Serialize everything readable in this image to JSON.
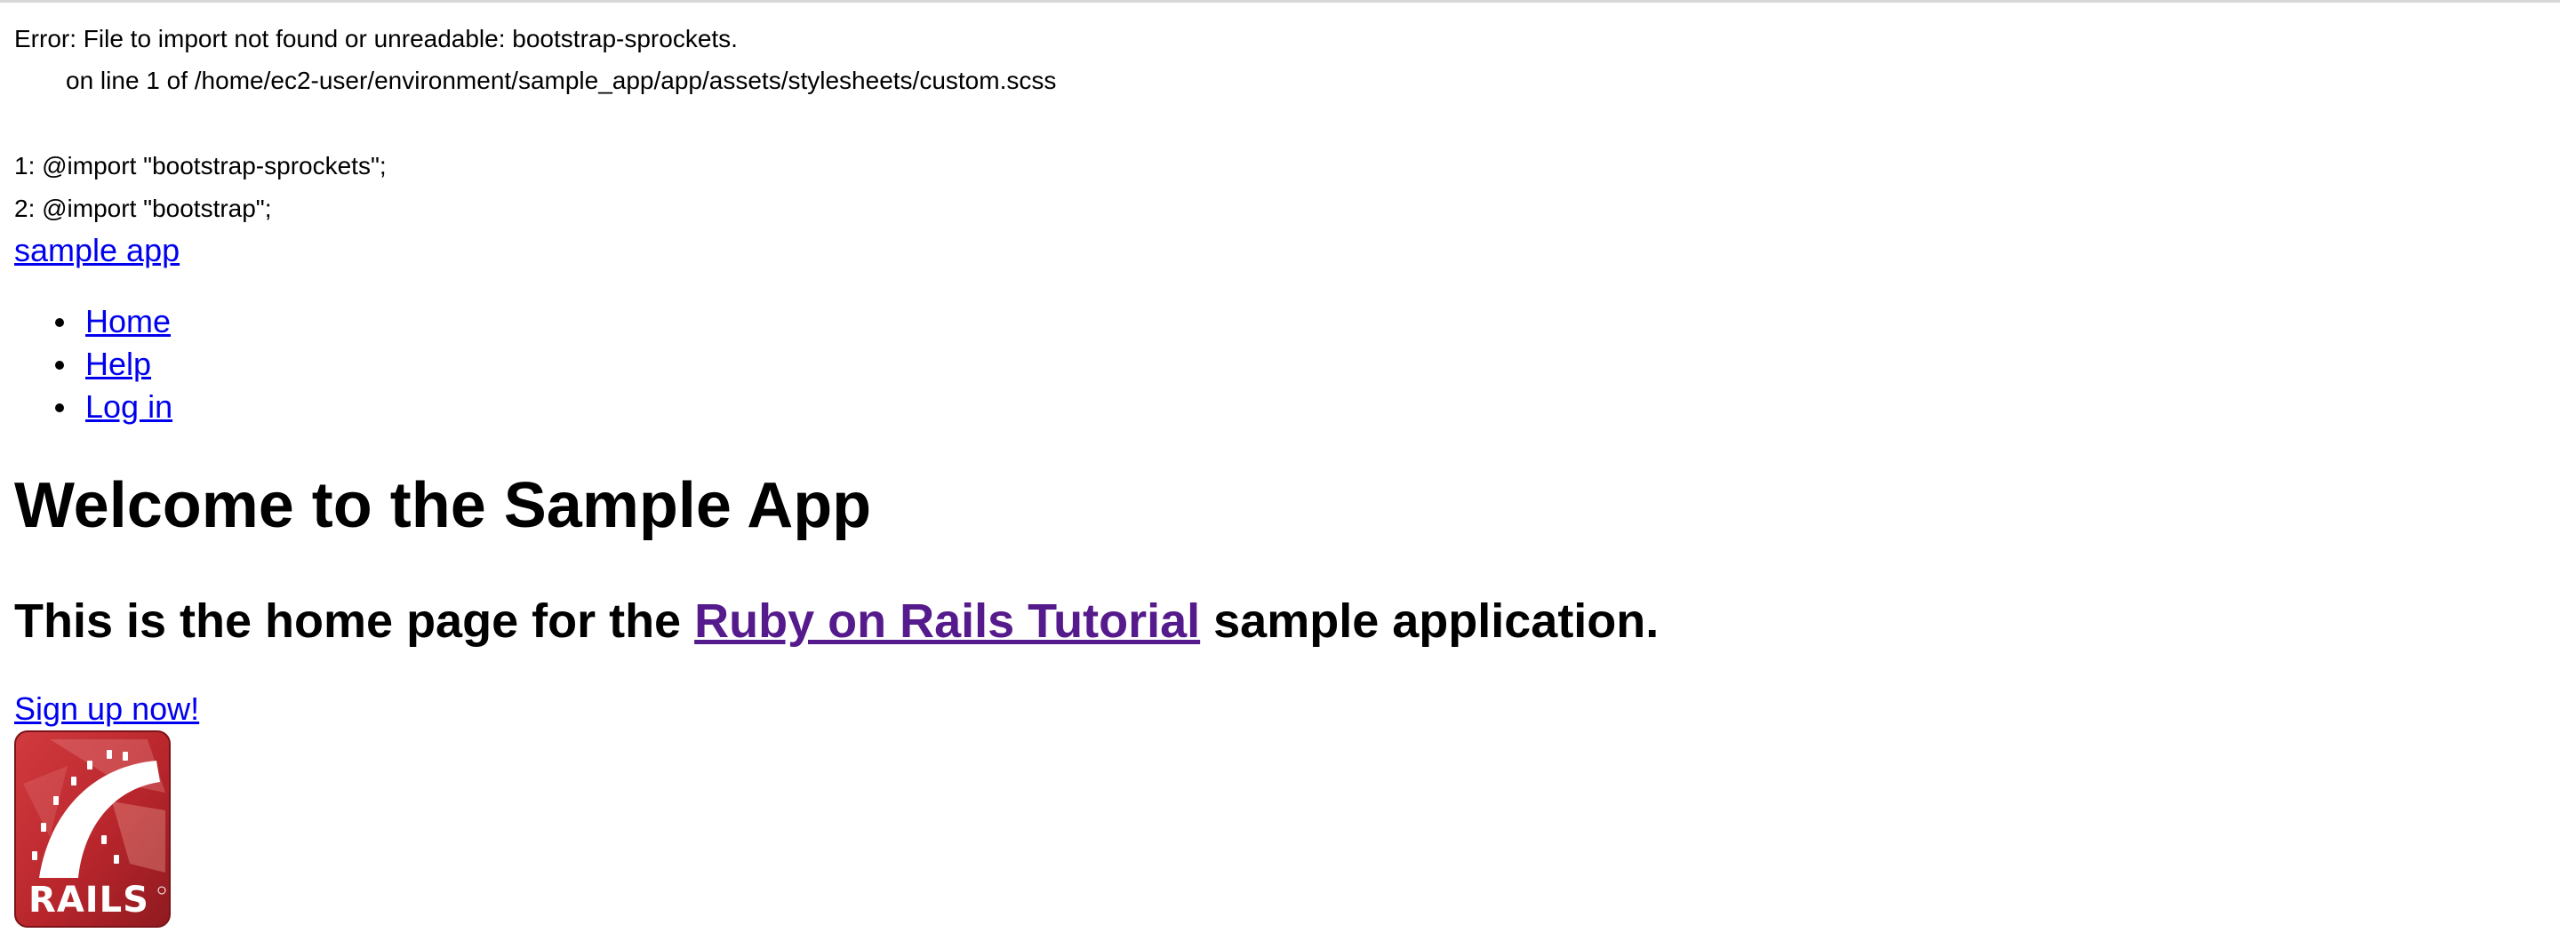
{
  "error": {
    "title": "Error: File to import not found or unreadable: bootstrap-sprockets.",
    "location": "on line 1 of /home/ec2-user/environment/sample_app/app/assets/stylesheets/custom.scss",
    "code_lines": [
      "1: @import \"bootstrap-sprockets\";",
      "2: @import \"bootstrap\";"
    ]
  },
  "header": {
    "logo_text": "sample app",
    "nav": [
      {
        "label": "Home"
      },
      {
        "label": "Help"
      },
      {
        "label": "Log in"
      }
    ]
  },
  "main": {
    "heading": "Welcome to the Sample App",
    "subheading_prefix": "This is the home page for the ",
    "subheading_link": "Ruby on Rails Tutorial",
    "subheading_suffix": " sample application.",
    "signup_label": "Sign up now!",
    "logo_text": "RAILS"
  },
  "colors": {
    "link": "#0000ee",
    "visited_link": "#551a8b",
    "rails_red": "#c1272d"
  }
}
